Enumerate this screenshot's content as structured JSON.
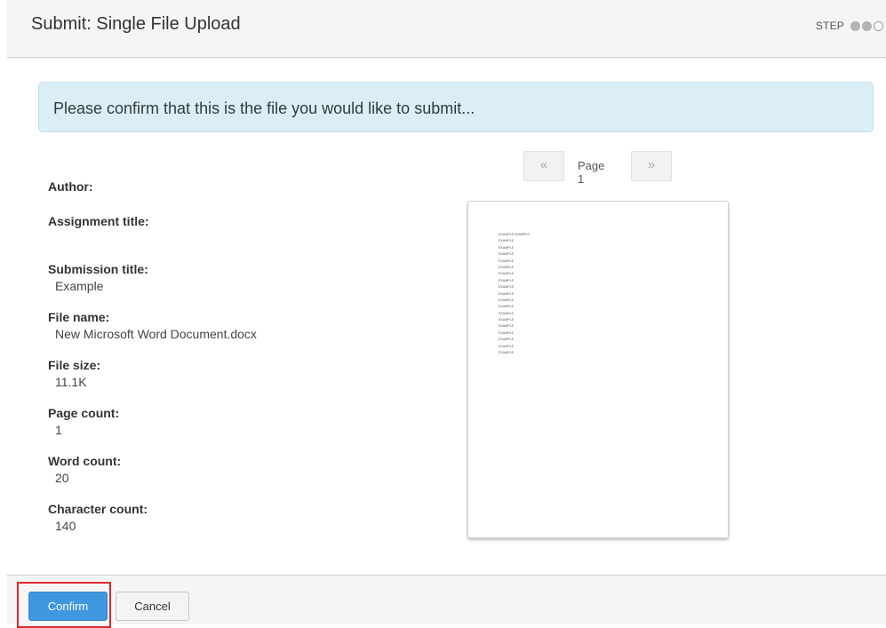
{
  "header": {
    "title": "Submit: Single File Upload",
    "step_label": "STEP",
    "steps": [
      "complete",
      "complete",
      "incomplete"
    ]
  },
  "alert": {
    "text": "Please confirm that this is the file you would like to submit..."
  },
  "details": {
    "author": {
      "label": "Author:",
      "value": ""
    },
    "assignment_title": {
      "label": "Assignment title:",
      "value": ""
    },
    "submission_title": {
      "label": "Submission title:",
      "value": "Example"
    },
    "file_name": {
      "label": "File name:",
      "value": "New Microsoft Word Document.docx"
    },
    "file_size": {
      "label": "File size:",
      "value": "11.1K"
    },
    "page_count": {
      "label": "Page count:",
      "value": "1"
    },
    "word_count": {
      "label": "Word count:",
      "value": "20"
    },
    "character_count": {
      "label": "Character count:",
      "value": "140"
    }
  },
  "pager": {
    "prev_label": "«",
    "page_label": "Page 1",
    "next_label": "»"
  },
  "preview": {
    "lines": [
      "EXAMPLE EXAMPLE",
      "EXAMPLE",
      "EXAMPLE",
      "EXAMPLE",
      "EXAMPLE",
      "EXAMPLE",
      "EXAMPLE",
      "EXAMPLE",
      "EXAMPLE",
      "EXAMPLE",
      "EXAMPLE",
      "EXAMPLE",
      "EXAMPLE",
      "EXAMPLE",
      "EXAMPLE",
      "EXAMPLE",
      "EXAMPLE",
      "EXAMPLE",
      "EXAMPLE"
    ]
  },
  "footer": {
    "confirm_label": "Confirm",
    "cancel_label": "Cancel"
  },
  "colors": {
    "confirm_button": "#3f97e0",
    "alert_background": "#dbeef6",
    "highlight_border": "#e0282c"
  }
}
